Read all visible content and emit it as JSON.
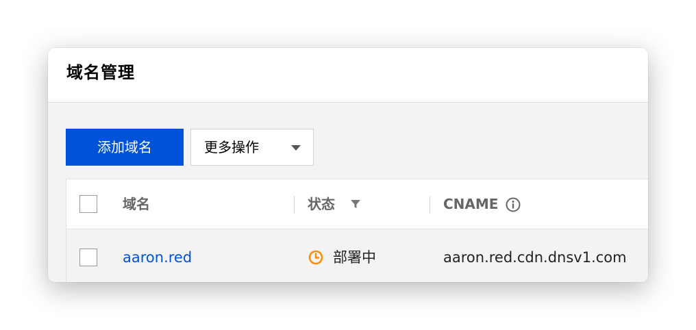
{
  "page": {
    "title": "域名管理"
  },
  "toolbar": {
    "add_domain_label": "添加域名",
    "more_actions_label": "更多操作"
  },
  "table": {
    "columns": {
      "domain": "域名",
      "status": "状态",
      "cname": "CNAME"
    },
    "rows": [
      {
        "domain": "aaron.red",
        "status": "部署中",
        "cname": "aaron.red.cdn.dnsv1.com"
      }
    ]
  },
  "icons": {
    "dropdown": "chevron-down-icon",
    "filter": "filter-icon",
    "info": "info-icon",
    "status": "clock-icon"
  },
  "colors": {
    "primary": "#0052d9",
    "link": "#0052d9",
    "status_pending": "#ff8c00"
  }
}
